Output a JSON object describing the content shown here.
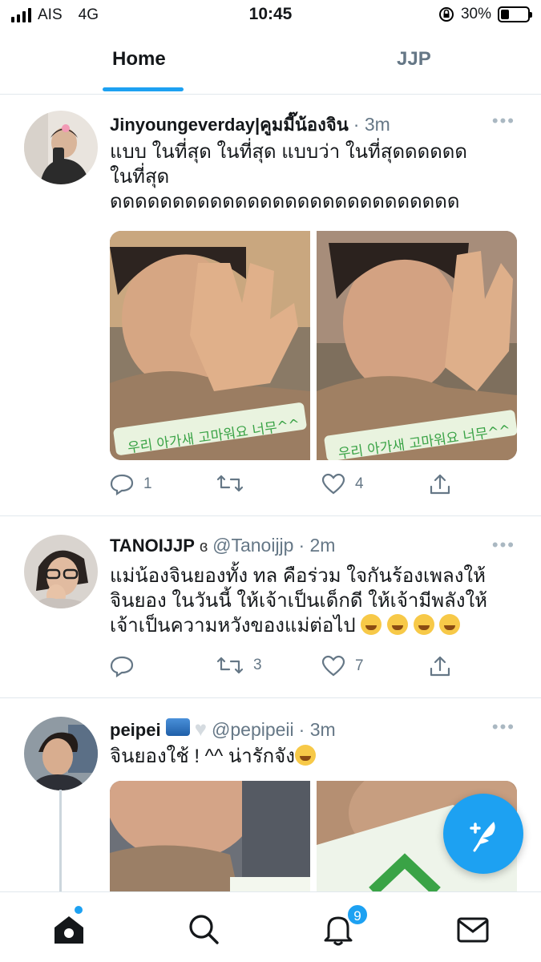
{
  "status_bar": {
    "carrier": "AIS",
    "network": "4G",
    "time": "10:45",
    "battery_percent": "30%",
    "battery_level": 0.3,
    "lock_icon": "orientation-lock-icon"
  },
  "tabs": [
    {
      "label": "Home",
      "active": true
    },
    {
      "label": "JJP",
      "active": false
    }
  ],
  "tweets": [
    {
      "display_name": "Jinyoungeverday|คูมมี๊น้องจิน",
      "handle": "",
      "time": "· 3m",
      "text_lines": [
        "แบบ ในที่สุด ในที่สุด แบบว่า ในที่สุดดดดดด",
        "ในที่สุด",
        "ดดดดดดดดดดดดดดดดดดดดดดดดดดดด"
      ],
      "replies": "1",
      "retweets": "",
      "likes": "4"
    },
    {
      "display_name": "TANOIJJP",
      "handle": "@Tanoijjp",
      "time": "· 2m",
      "text_lines": [
        "แม่น้องจินยองทั้ง ทล คือร่วม ใจกันร้องเพลงให้",
        "จินยอง ในวันนี้ ให้เจ้าเป็นเด็กดี ให้เจ้ามีพลังให้",
        "เจ้าเป็นความหวังของแม่ต่อไป"
      ],
      "replies": "",
      "retweets": "3",
      "likes": "7"
    },
    {
      "display_name": "peipei",
      "handle": "@pepipeii",
      "time": "· 3m",
      "text_lines": [
        "จินยองใช้ ! ^^ น่ารักจัง"
      ]
    }
  ],
  "media_captions": [
    "우리 아가새 고마워요 너무^^",
    "우리 아가새 고마워요 너무^^"
  ],
  "bottom_nav": {
    "notifications_badge": "9"
  },
  "colors": {
    "accent": "#1da1f2",
    "secondary_text": "#657786",
    "border": "#e1e8ed"
  }
}
